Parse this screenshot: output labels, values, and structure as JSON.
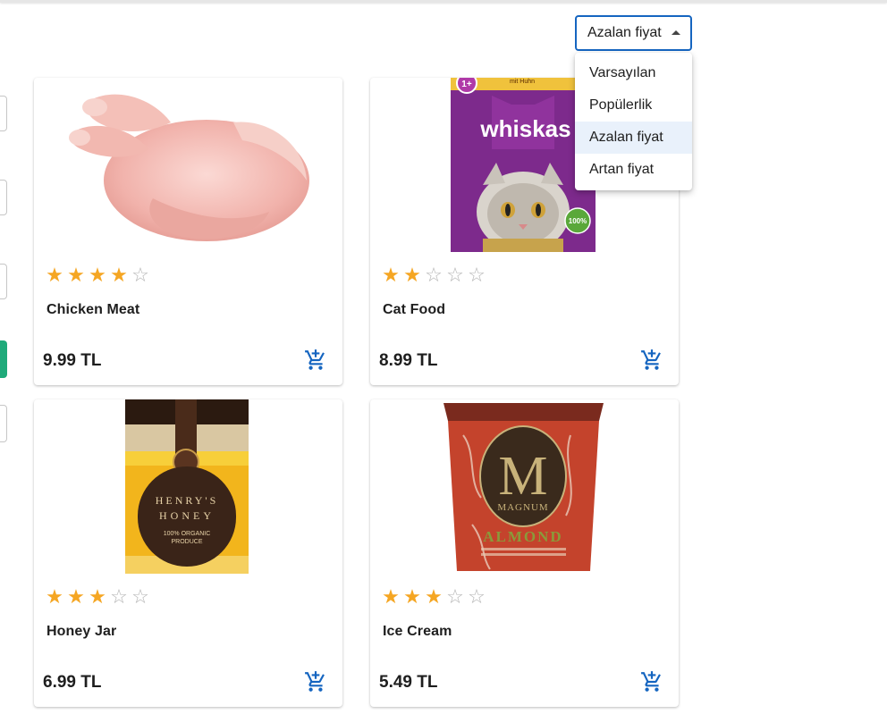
{
  "sort": {
    "selected": "Azalan fiyat",
    "options": [
      "Varsayılan",
      "Popülerlik",
      "Azalan fiyat",
      "Artan fiyat"
    ]
  },
  "products": [
    {
      "name": "Chicken Meat",
      "price": "9.99 TL",
      "rating": 4,
      "image_icon": "raw-chicken-image"
    },
    {
      "name": "Cat Food",
      "price": "8.99 TL",
      "rating": 2,
      "image_icon": "whiskas-pouch-image",
      "image_text": {
        "brand": "whiskas",
        "badge": "1+",
        "top_label": "mit Huhn",
        "seal": "100%"
      }
    },
    {
      "name": "Honey Jar",
      "price": "6.99 TL",
      "rating": 3,
      "image_icon": "honey-jar-image",
      "image_text": {
        "line1": "HENRY'S",
        "line2": "HONEY",
        "line3": "100% ORGANIC",
        "line4": "PRODUCE"
      }
    },
    {
      "name": "Ice Cream",
      "price": "5.49 TL",
      "rating": 3,
      "image_icon": "magnum-tub-image",
      "image_text": {
        "letter": "M",
        "brand": "MAGNUM",
        "flavor": "ALMOND"
      }
    }
  ],
  "colors": {
    "accent": "#1565c0",
    "star": "#f5a623",
    "filter_green": "#1faa7a"
  }
}
